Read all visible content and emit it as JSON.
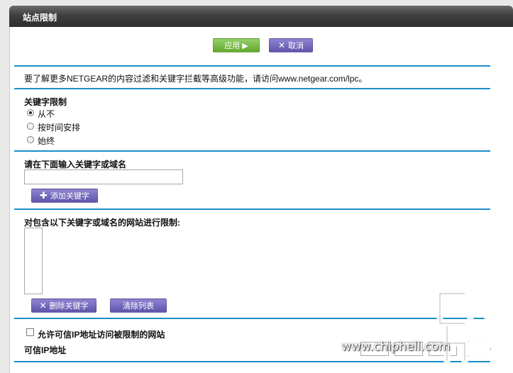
{
  "window": {
    "title": "站点限制"
  },
  "toolbar": {
    "apply_label": "应用 ▶",
    "cancel_label": "取消",
    "cancel_icon": "close-icon"
  },
  "info": {
    "text": "要了解更多NETGEAR的内容过滤和关键字拦截等高级功能，请访问www.netgear.com/lpc。"
  },
  "keyword_block": {
    "heading": "关键字限制",
    "options": [
      {
        "label": "从不",
        "selected": true
      },
      {
        "label": "按时间安排",
        "selected": false
      },
      {
        "label": "始终",
        "selected": false
      }
    ]
  },
  "keyword_entry": {
    "heading": "请在下面输入关键字或域名",
    "value": "",
    "add_label": "添加关键字",
    "add_icon": "plus-icon"
  },
  "blocked_list": {
    "heading": "对包含以下关键字或域名的网站进行限制:",
    "items": [],
    "delete_label": "删除关键字",
    "delete_icon": "close-icon",
    "clear_label": "清除列表"
  },
  "trusted": {
    "allow_label": "允许可信IP地址访问被限制的网站",
    "allow_checked": false,
    "ip_label": "可信IP地址"
  },
  "watermark": {
    "logo_text": "chip hell",
    "url": "www.chiphell.com"
  }
}
